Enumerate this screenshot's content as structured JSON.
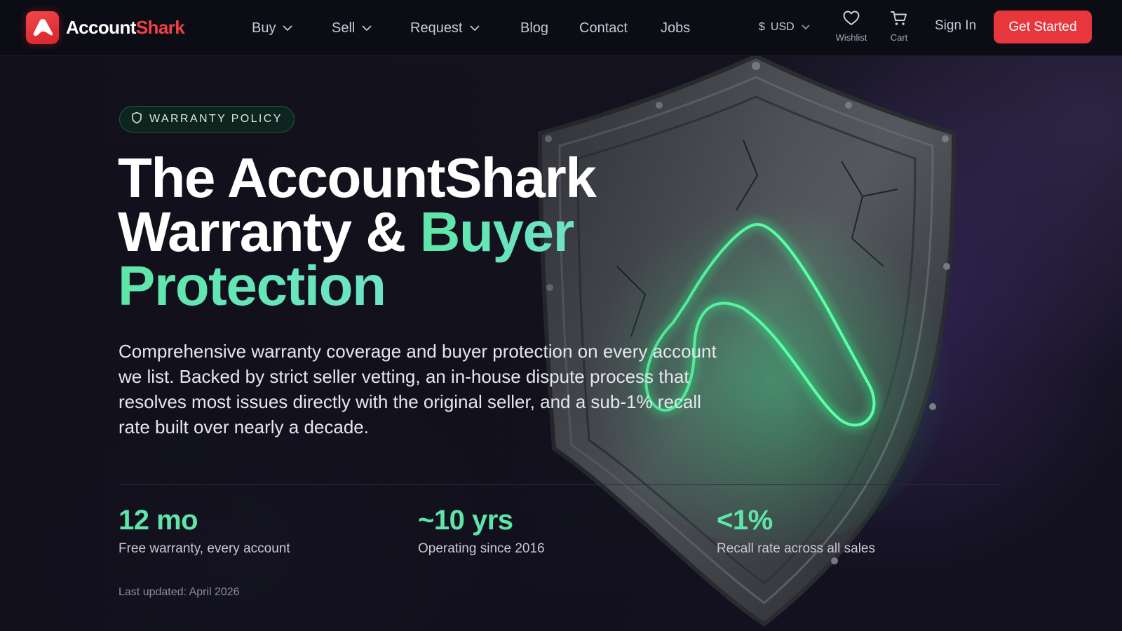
{
  "brand": {
    "name_part1": "Account",
    "name_part2": "Shark"
  },
  "nav": {
    "items": [
      {
        "label": "Buy",
        "dropdown": true
      },
      {
        "label": "Sell",
        "dropdown": true
      },
      {
        "label": "Request",
        "dropdown": true
      },
      {
        "label": "Blog",
        "dropdown": false
      },
      {
        "label": "Contact",
        "dropdown": false
      },
      {
        "label": "Jobs",
        "dropdown": false
      }
    ],
    "currency": {
      "symbol": "$",
      "code": "USD"
    },
    "wishlist_label": "Wishlist",
    "cart_label": "Cart",
    "signin_label": "Sign In",
    "cta_label": "Get Started"
  },
  "hero": {
    "badge": "WARRANTY POLICY",
    "headline": {
      "line1": "The AccountShark",
      "line2_plain": "Warranty & ",
      "line2_highlight": "Buyer",
      "line3_highlight": "Protection"
    },
    "subtitle": "Comprehensive warranty coverage and buyer protection on every account we list. Backed by strict seller vetting, an in-house dispute process that resolves most issues directly with the original seller, and a sub-1% recall rate built over nearly a decade.",
    "stats": [
      {
        "value": "12 mo",
        "label": "Free warranty, every account"
      },
      {
        "value": "~10 yrs",
        "label": "Operating since 2016"
      },
      {
        "value": "<1%",
        "label": "Recall rate across all sales"
      }
    ],
    "last_updated": "Last updated: April 2026"
  },
  "colors": {
    "brand_red": "#e8373c",
    "accent_green": "#5ee6a9",
    "nav_bg": "#0c0c14",
    "hero_bg": "#15131f"
  },
  "icons": {
    "logo": "accountshark-logo-icon",
    "badge": "shield-icon",
    "wishlist": "heart-icon",
    "cart": "cart-icon",
    "dropdown": "chevron-down-icon"
  }
}
